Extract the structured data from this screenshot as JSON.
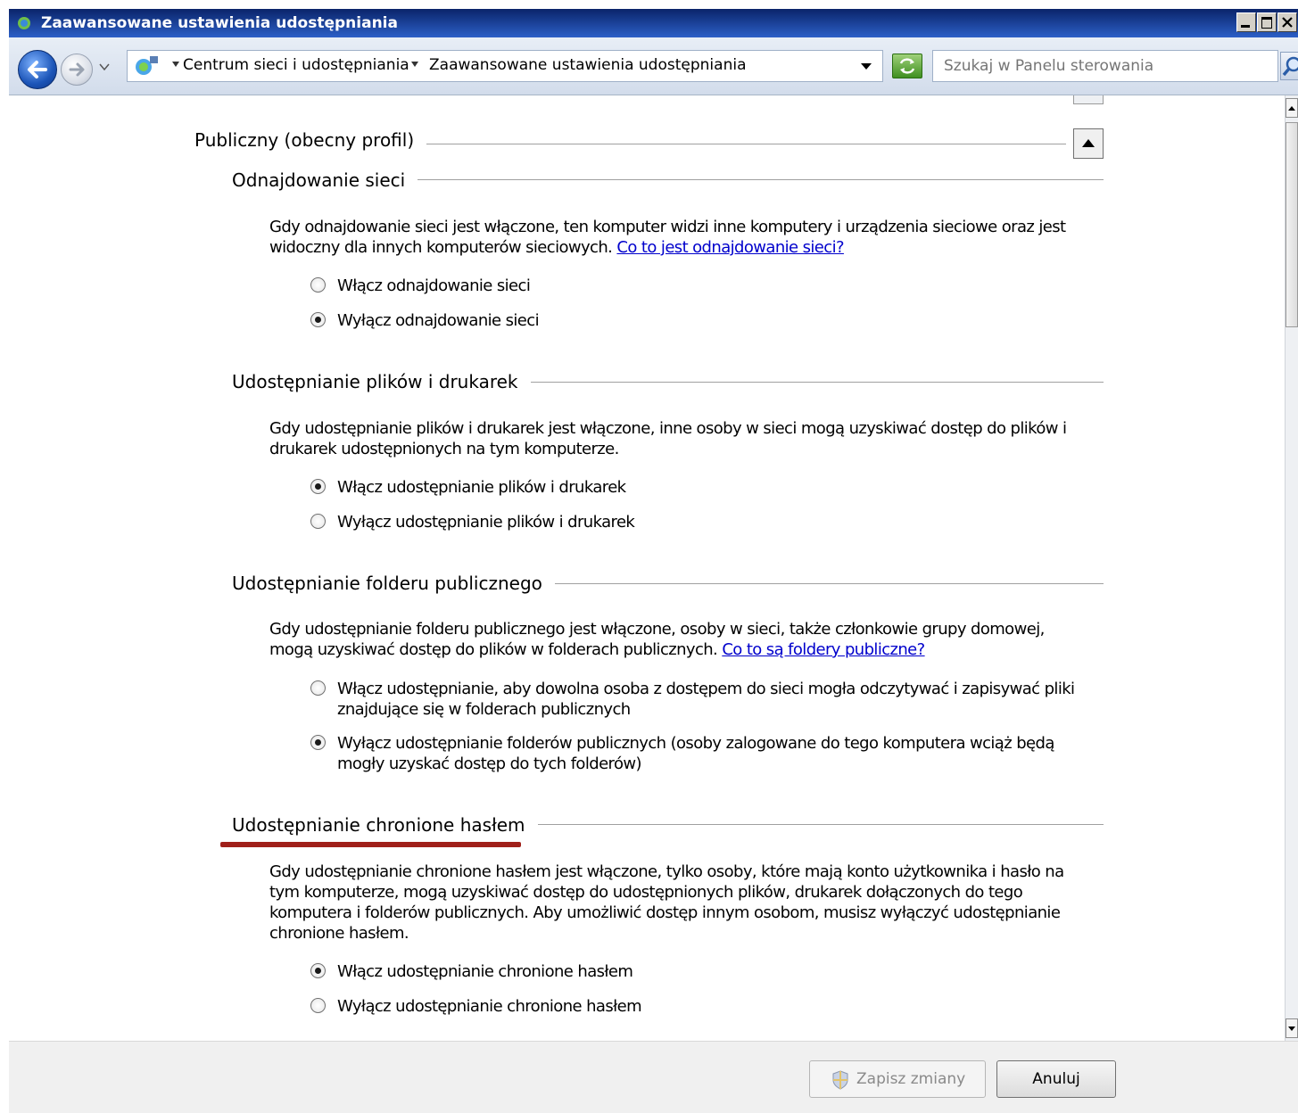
{
  "window": {
    "title": "Zaawansowane ustawienia udostępniania"
  },
  "address_bar": {
    "crumbs": [
      "Centrum sieci i udostępniania",
      "Zaawansowane ustawienia udostępniania"
    ],
    "search_placeholder": "Szukaj w Panelu sterowania"
  },
  "profile": {
    "title": "Publiczny (obecny profil)"
  },
  "sections": [
    {
      "title": "Odnajdowanie sieci",
      "description": "Gdy odnajdowanie sieci jest włączone, ten komputer widzi inne komputery i urządzenia sieciowe oraz jest widoczny dla innych komputerów sieciowych.",
      "link": "Co to jest odnajdowanie sieci?",
      "options": [
        {
          "label": "Włącz odnajdowanie sieci",
          "checked": false
        },
        {
          "label": "Wyłącz odnajdowanie sieci",
          "checked": true
        }
      ]
    },
    {
      "title": "Udostępnianie plików i drukarek",
      "description": "Gdy udostępnianie plików i drukarek jest włączone, inne osoby w sieci mogą uzyskiwać dostęp do plików i drukarek udostępnionych na tym komputerze.",
      "options": [
        {
          "label": "Włącz udostępnianie plików i drukarek",
          "checked": true
        },
        {
          "label": "Wyłącz udostępnianie plików i drukarek",
          "checked": false
        }
      ]
    },
    {
      "title": "Udostępnianie folderu publicznego",
      "description": "Gdy udostępnianie folderu publicznego jest włączone, osoby w sieci, także członkowie grupy domowej, mogą uzyskiwać dostęp do plików w folderach publicznych.",
      "link": "Co to są foldery publiczne?",
      "options": [
        {
          "label": "Włącz udostępnianie, aby dowolna osoba z dostępem do sieci mogła odczytywać i zapisywać pliki znajdujące się w folderach publicznych",
          "checked": false
        },
        {
          "label": "Wyłącz udostępnianie folderów publicznych (osoby zalogowane do tego komputera wciąż będą mogły uzyskać dostęp do tych folderów)",
          "checked": true
        }
      ]
    },
    {
      "title": "Udostępnianie chronione hasłem",
      "description": "Gdy udostępnianie chronione hasłem jest włączone, tylko osoby, które mają konto użytkownika i hasło na tym komputerze, mogą uzyskiwać dostęp do udostępnionych plików, drukarek dołączonych do tego komputera i folderów publicznych. Aby umożliwić dostęp innym osobom, musisz wyłączyć udostępnianie chronione hasłem.",
      "options": [
        {
          "label": "Włącz udostępnianie chronione hasłem",
          "checked": true
        },
        {
          "label": "Wyłącz udostępnianie chronione hasłem",
          "checked": false
        }
      ]
    }
  ],
  "footer": {
    "save_label": "Zapisz zmiany",
    "cancel_label": "Anuluj"
  },
  "colors": {
    "title_bar": "#0a246a",
    "link": "#0000cc",
    "annotation_underline": "#a0201a"
  }
}
